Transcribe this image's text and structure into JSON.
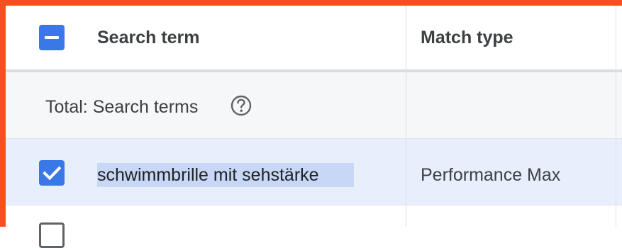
{
  "table": {
    "columns": [
      "Search term",
      "Match type"
    ],
    "total_label": "Total: Search terms",
    "rows": [
      {
        "search_term": "schwimmbrille mit sehstärke",
        "match_type": "Performance Max",
        "selected": true
      }
    ]
  },
  "icons": {
    "header_checkbox": "checkbox-indeterminate-icon",
    "row_checkbox": "checkbox-checked-icon",
    "help": "help-circle-icon"
  },
  "colors": {
    "accent": "#3b78e7",
    "frame": "#f4511e",
    "selected_row": "#e8effc",
    "text_highlight": "#c7d7f5"
  }
}
